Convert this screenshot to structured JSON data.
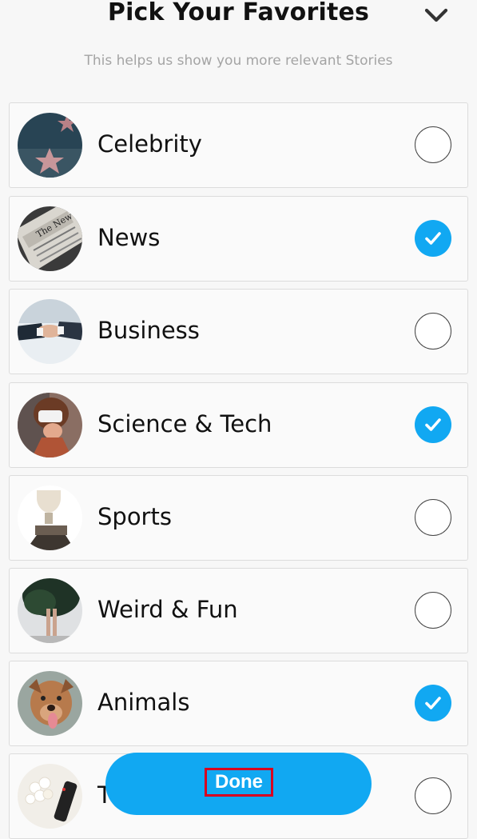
{
  "header": {
    "title": "Pick Your Favorites",
    "collapse_icon": "chevron-down-icon",
    "subtitle": "This helps us show you more relevant Stories"
  },
  "categories": [
    {
      "label": "Celebrity",
      "selected": false,
      "thumb": "walk-of-fame-star"
    },
    {
      "label": "News",
      "selected": true,
      "thumb": "newspaper"
    },
    {
      "label": "Business",
      "selected": false,
      "thumb": "handshake"
    },
    {
      "label": "Science & Tech",
      "selected": true,
      "thumb": "vr-headset"
    },
    {
      "label": "Sports",
      "selected": false,
      "thumb": "trophy"
    },
    {
      "label": "Weird & Fun",
      "selected": false,
      "thumb": "tree-legs"
    },
    {
      "label": "Animals",
      "selected": true,
      "thumb": "dog"
    },
    {
      "label": "T",
      "selected": false,
      "thumb": "popcorn-remote"
    }
  ],
  "done_button": {
    "label": "Done"
  },
  "colors": {
    "accent": "#11a8f2",
    "highlight_box": "#d8001f"
  }
}
